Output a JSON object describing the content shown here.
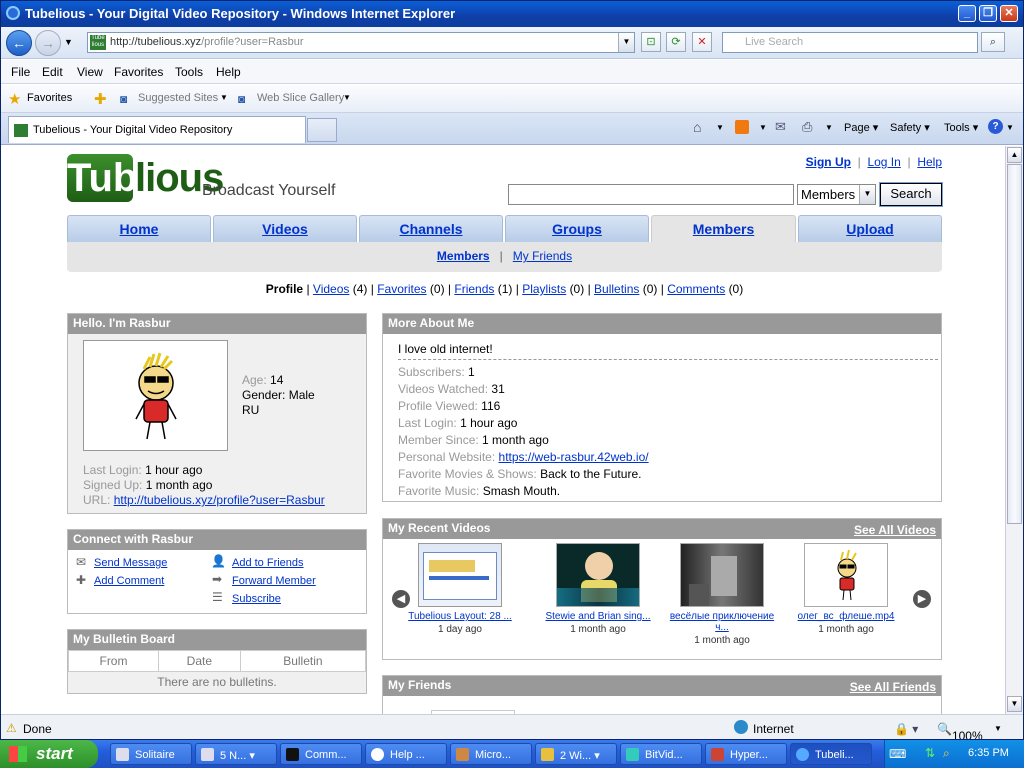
{
  "window": {
    "title": "Tubelious - Your Digital Video Repository - Windows Internet Explorer"
  },
  "browser": {
    "url_host": "http://tubelious.xyz",
    "url_path": "/profile?user=Rasbur",
    "live_search_placeholder": "Live Search",
    "menu": [
      "File",
      "Edit",
      "View",
      "Favorites",
      "Tools",
      "Help"
    ],
    "favorites_label": "Favorites",
    "suggested_sites": "Suggested Sites",
    "web_slice": "Web Slice Gallery",
    "tab_title": "Tubelious - Your Digital Video Repository",
    "cmd": {
      "page": "Page",
      "safety": "Safety",
      "tools": "Tools"
    },
    "status": {
      "text": "Done",
      "zone": "Internet",
      "zoom": "100%"
    }
  },
  "site": {
    "logo_box": "Tube",
    "logo_rest": "lious",
    "tagline": "Broadcast Yourself",
    "toplinks": {
      "signup": "Sign Up",
      "login": "Log In",
      "help": "Help"
    },
    "search": {
      "select": "Members",
      "button": "Search"
    },
    "nav": [
      "Home",
      "Videos",
      "Channels",
      "Groups",
      "Members",
      "Upload"
    ],
    "subnav": {
      "members": "Members",
      "friends": "My Friends"
    },
    "profile_line": {
      "profile": "Profile",
      "videos": "Videos",
      "videos_n": "(4)",
      "favorites": "Favorites",
      "favorites_n": "(0)",
      "friends": "Friends",
      "friends_n": "(1)",
      "playlists": "Playlists",
      "playlists_n": "(0)",
      "bulletins": "Bulletins",
      "bulletins_n": "(0)",
      "comments": "Comments",
      "comments_n": "(0)"
    }
  },
  "hello": {
    "title": "Hello. I'm Rasbur",
    "age_label": "Age:",
    "age": "14",
    "gender": "Gender: Male",
    "country": "RU",
    "last_login_label": "Last Login:",
    "last_login": "1 hour ago",
    "signed_up_label": "Signed Up:",
    "signed_up": "1 month ago",
    "url_label": "URL:",
    "url": "http://tubelious.xyz/profile?user=Rasbur"
  },
  "connect": {
    "title": "Connect with Rasbur",
    "send": "Send Message",
    "add_friend": "Add to Friends",
    "comment": "Add Comment",
    "forward": "Forward Member",
    "subscribe": "Subscribe"
  },
  "bulletin": {
    "title": "My Bulletin Board",
    "cols": [
      "From",
      "Date",
      "Bulletin"
    ],
    "empty": "There are no bulletins."
  },
  "about": {
    "title": "More About Me",
    "intro": "I love old internet!",
    "rows": [
      {
        "label": "Subscribers:",
        "value": "1"
      },
      {
        "label": "Videos Watched:",
        "value": "31"
      },
      {
        "label": "Profile Viewed:",
        "value": "116"
      },
      {
        "label": "Last Login:",
        "value": "1 hour ago"
      },
      {
        "label": "Member Since:",
        "value": "1 month ago"
      },
      {
        "label": "Personal Website:",
        "value": "https://web-rasbur.42web.io/",
        "link": true
      },
      {
        "label": "Favorite Movies & Shows:",
        "value": "Back to the Future."
      },
      {
        "label": "Favorite Music:",
        "value": "Smash Mouth."
      }
    ]
  },
  "recent": {
    "title": "My Recent Videos",
    "see_all": "See All Videos",
    "videos": [
      {
        "title": "Tubelious Layout: 28 ...",
        "ago": "1 day ago"
      },
      {
        "title": "Stewie and Brian sing...",
        "ago": "1 month ago"
      },
      {
        "title": "весёлые приключение ч...",
        "ago": "1 month ago"
      },
      {
        "title": "олег_вс_флеше.mp4",
        "ago": "1 month ago"
      }
    ]
  },
  "friends": {
    "title": "My Friends",
    "see_all": "See All Friends"
  },
  "taskbar": {
    "start": "start",
    "tasks": [
      "Solitaire",
      "5 N...",
      "Comm...",
      "Help ...",
      "Micro...",
      "2 Wi...",
      "BitVid...",
      "Hyper...",
      "Tubeli..."
    ],
    "clock": "6:35 PM"
  }
}
